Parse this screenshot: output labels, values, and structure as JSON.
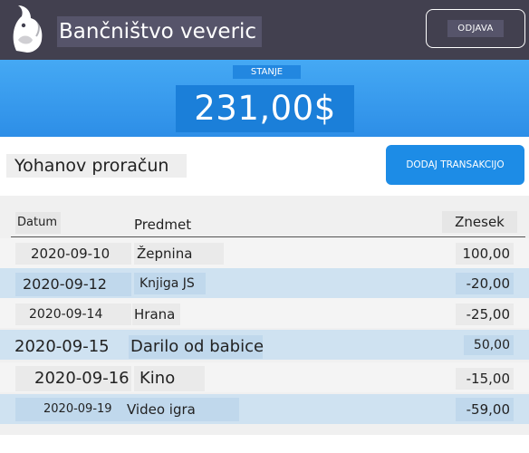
{
  "header": {
    "app_title": "Bančništvo veveric",
    "logout_label": "ODJAVA",
    "logo_icon": "squirrel-logo-icon"
  },
  "balance": {
    "label": "STANJE",
    "amount": "231,00$"
  },
  "budget": {
    "title": "Yohanov proračun",
    "add_button_label": "DODAJ TRANSAKCIJO"
  },
  "table": {
    "columns": [
      "Datum",
      "Predmet",
      "Znesek"
    ],
    "rows": [
      {
        "date": "2020-09-10",
        "item": "Žepnina",
        "amount": "100,00"
      },
      {
        "date": "2020-09-12",
        "item": "Knjiga JS",
        "amount": "-20,00"
      },
      {
        "date": "2020-09-14",
        "item": "Hrana",
        "amount": "-25,00"
      },
      {
        "date": "2020-09-15",
        "item": "Darilo od babice",
        "amount": "50,00"
      },
      {
        "date": "2020-09-16",
        "item": "Kino",
        "amount": "-15,00"
      },
      {
        "date": "2020-09-19",
        "item": "Video igra",
        "amount": "-59,00"
      }
    ]
  },
  "colors": {
    "header_bg": "#42404f",
    "balance_bg": "#2d8ee7",
    "accent": "#1d8ce6",
    "row_alt": "#cfe2f1"
  }
}
